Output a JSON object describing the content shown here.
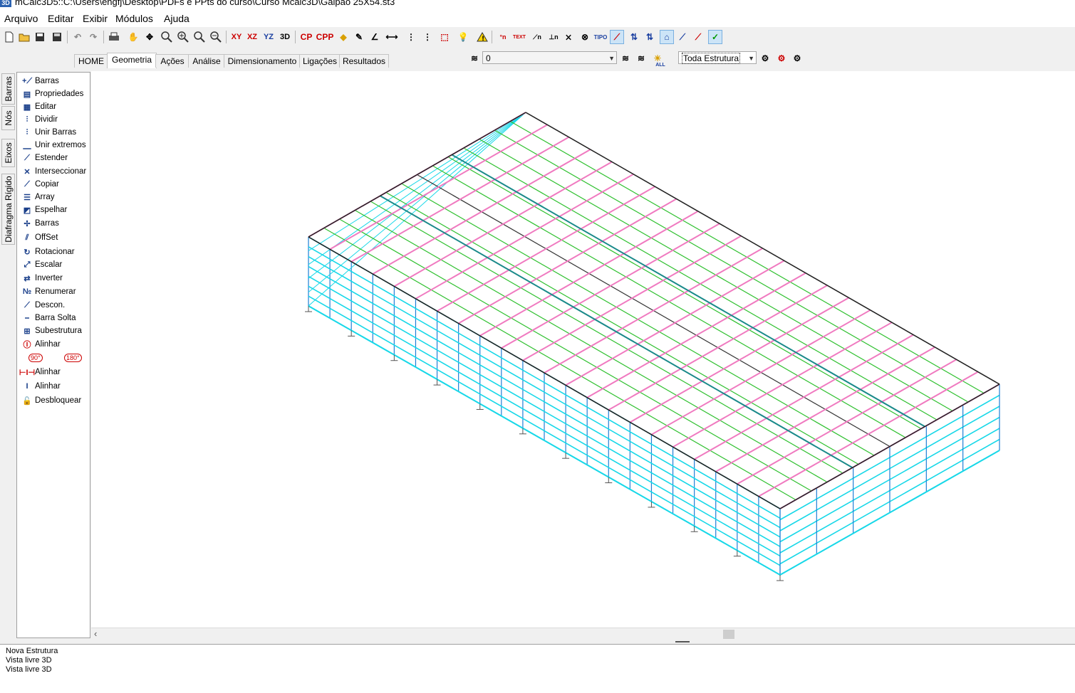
{
  "window": {
    "title": "mCalc3D5::C:\\Users\\engfj\\Desktop\\PDFs e PPts do curso\\Curso Mcalc3D\\Galpão 25X54.st3",
    "icon_text": "3D"
  },
  "menu": [
    "Arquivo",
    "Editar",
    "Exibir",
    "Módulos",
    "Ajuda"
  ],
  "toolbar": {
    "labels": {
      "xy": "XY",
      "xz": "XZ",
      "yz": "YZ",
      "view3d": "3D",
      "cp": "CP",
      "cpp": "CPP",
      "text": "TEXT",
      "tipo": "TIPO",
      "all": "ALL"
    }
  },
  "tabs": [
    "HOME",
    "Geometria",
    "Ações",
    "Análise",
    "Dimensionamento",
    "Ligações",
    "Resultados"
  ],
  "active_tab": "Geometria",
  "layer_select": {
    "value": "0"
  },
  "structure_select": {
    "value": "Toda Estrutura"
  },
  "side_tabs": [
    "Barras",
    "Nós",
    "Eixos",
    "Diafragma Rígido"
  ],
  "panel_items": [
    "Barras",
    "Propriedades",
    "Editar",
    "Dividir",
    "Unir Barras",
    "Unir extremos",
    "Estender",
    "Interseccionar",
    "Copiar",
    "Array",
    "Espelhar",
    "Barras",
    "OffSet",
    "Rotacionar",
    "Escalar",
    "Inverter",
    "Renumerar",
    "Descon.",
    "Barra Solta",
    "Subestrutura",
    "Alinhar",
    "Alinhar",
    "Alinhar",
    "Desbloquear"
  ],
  "rotate_buttons": [
    "90°",
    "180°"
  ],
  "log_lines": [
    "Nova Estrutura",
    "Vista livre 3D",
    "Vista livre 3D"
  ]
}
